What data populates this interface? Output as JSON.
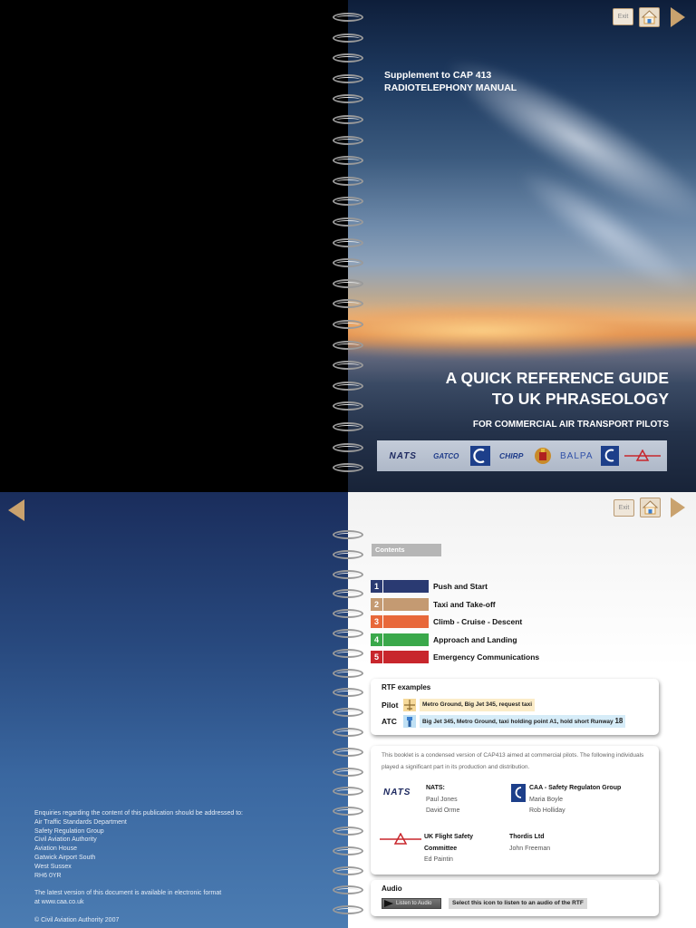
{
  "cover": {
    "supplement_line1": "Supplement to CAP 413",
    "supplement_line2": "RADIOTELEPHONY MANUAL",
    "title_line1": "A QUICK REFERENCE GUIDE",
    "title_line2": "TO UK PHRASEOLOGY",
    "subtitle": "FOR COMMERCIAL AIR TRANSPORT PILOTS",
    "logos": [
      "NATS",
      "GATCO",
      "CAA",
      "CHIRP",
      "Coat of arms",
      "BALPA",
      "CAA",
      "UK Flight Safety Committee"
    ]
  },
  "nav": {
    "exit_label": "Exit",
    "home_icon": "home-icon",
    "next_icon": "arrow-right-icon",
    "prev_icon": "arrow-left-icon",
    "accent": "#c9a26e"
  },
  "contents": {
    "heading": "Contents",
    "items": [
      {
        "num": "1",
        "label": "Push and Start",
        "color": "#2a3a72"
      },
      {
        "num": "2",
        "label": "Taxi and Take-off",
        "color": "#c49a72"
      },
      {
        "num": "3",
        "label": "Climb - Cruise - Descent",
        "color": "#e8683a"
      },
      {
        "num": "4",
        "label": "Approach and Landing",
        "color": "#3aa84a"
      },
      {
        "num": "5",
        "label": "Emergency Communications",
        "color": "#c8262c"
      }
    ]
  },
  "rtf": {
    "heading": "RTF examples",
    "pilot_label": "Pilot",
    "pilot_text": "Metro Ground, Big Jet 345, request taxi",
    "pilot_color": "#fbecc8",
    "atc_label": "ATC",
    "atc_text": "Big Jet 345, Metro Ground, taxi holding point A1, hold short Runway",
    "atc_runway": "18",
    "atc_color": "#d6ecf8"
  },
  "credits": {
    "intro": "This booklet is a condensed version of CAP413 aimed at commercial pilots. The following individuals played a significant part in its production and distribution.",
    "nats_heading": "NATS:",
    "nats_people": [
      "Paul Jones",
      "David Orme"
    ],
    "caa_heading": "CAA - Safety Regulaton Group",
    "caa_people": [
      "Maria Boyle",
      "Rob Holliday"
    ],
    "ukfsc_heading_line1": "UK Flight Safety",
    "ukfsc_heading_line2": "Committee",
    "ukfsc_people": [
      "Ed Paintin"
    ],
    "thordis_heading": "Thordis Ltd",
    "thordis_people": [
      "John Freeman"
    ],
    "nats_logo_text": "NATS"
  },
  "audio": {
    "heading": "Audio",
    "button_label": "Listen to Audio",
    "description": "Select this icon to listen to an audio of the RTF"
  },
  "enquiries": {
    "lines": [
      "Enquiries regarding the content of this publication should be addressed to:",
      "Air Traffic Standards Department",
      "Safety Regulation Group",
      "Civil Aviation Authority",
      "Aviation House",
      "Gatwick Airport South",
      "West Sussex",
      "RH6 0YR"
    ],
    "electronic_line1": "The latest version of this document is available in electronic format",
    "electronic_line2": "at www.caa.co.uk",
    "copyright": "© Civil Aviation Authority 2007"
  }
}
